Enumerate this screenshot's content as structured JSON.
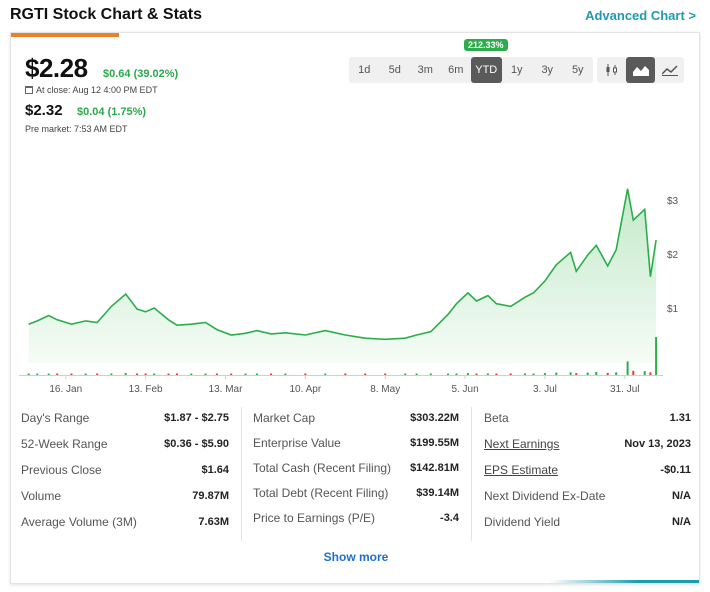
{
  "header": {
    "title": "RGTI Stock Chart & Stats",
    "advanced_link": "Advanced Chart >"
  },
  "quote": {
    "price": "$2.28",
    "change": "$0.64 (39.02%)",
    "close_label": "At close: Aug 12 4:00 PM EDT",
    "premarket_price": "$2.32",
    "premarket_change": "$0.04 (1.75%)",
    "premarket_label": "Pre market: 7:53 AM EDT"
  },
  "range": {
    "buttons": [
      "1d",
      "5d",
      "3m",
      "6m",
      "YTD",
      "1y",
      "3y",
      "5y"
    ],
    "active": "YTD",
    "badge": "212.33%"
  },
  "chart_types": [
    {
      "icon": "candlestick-icon",
      "active": false
    },
    {
      "icon": "mountain-chart-icon",
      "active": true
    },
    {
      "icon": "line-chart-icon",
      "active": false
    }
  ],
  "colors": {
    "line": "#2bae4a",
    "fill": "#bfe8c6",
    "positive": "#2ba84a",
    "accent": "#e8812a",
    "link": "#1e9bb0",
    "volume_up": "#2bae4a",
    "volume_down": "#e23b3b"
  },
  "chart_data": {
    "type": "area",
    "x_tick_labels": [
      "16. Jan",
      "13. Feb",
      "13. Mar",
      "10. Apr",
      "8. May",
      "5. Jun",
      "3. Jul",
      "31. Jul"
    ],
    "y_tick_labels": [
      "$3",
      "$2",
      "$1"
    ],
    "ylim": [
      0,
      3.3
    ],
    "x": [
      "2023-01-03",
      "2023-01-06",
      "2023-01-10",
      "2023-01-13",
      "2023-01-18",
      "2023-01-23",
      "2023-01-27",
      "2023-02-01",
      "2023-02-06",
      "2023-02-10",
      "2023-02-13",
      "2023-02-16",
      "2023-02-21",
      "2023-02-24",
      "2023-03-01",
      "2023-03-06",
      "2023-03-10",
      "2023-03-15",
      "2023-03-20",
      "2023-03-24",
      "2023-03-29",
      "2023-04-03",
      "2023-04-10",
      "2023-04-17",
      "2023-04-24",
      "2023-05-01",
      "2023-05-08",
      "2023-05-15",
      "2023-05-19",
      "2023-05-24",
      "2023-05-30",
      "2023-06-02",
      "2023-06-06",
      "2023-06-09",
      "2023-06-13",
      "2023-06-16",
      "2023-06-21",
      "2023-06-26",
      "2023-06-29",
      "2023-07-03",
      "2023-07-07",
      "2023-07-12",
      "2023-07-14",
      "2023-07-18",
      "2023-07-21",
      "2023-07-25",
      "2023-07-28",
      "2023-08-01",
      "2023-08-03",
      "2023-08-07",
      "2023-08-09",
      "2023-08-11"
    ],
    "values": [
      0.72,
      0.78,
      0.88,
      0.8,
      0.72,
      0.78,
      0.75,
      1.05,
      1.28,
      1.0,
      0.95,
      1.02,
      0.8,
      0.7,
      0.72,
      0.75,
      0.62,
      0.52,
      0.55,
      0.6,
      0.54,
      0.56,
      0.52,
      0.6,
      0.52,
      0.46,
      0.44,
      0.46,
      0.52,
      0.58,
      0.9,
      1.1,
      1.3,
      1.15,
      1.25,
      1.1,
      1.05,
      1.22,
      1.3,
      1.52,
      1.82,
      2.05,
      1.7,
      2.0,
      2.18,
      1.8,
      2.1,
      3.23,
      2.65,
      2.85,
      1.6,
      2.28
    ],
    "volume": [
      0.08,
      0.05,
      0.06,
      0.04,
      0.05,
      0.06,
      0.04,
      0.12,
      0.15,
      0.08,
      0.06,
      0.05,
      0.05,
      0.04,
      0.04,
      0.04,
      0.05,
      0.04,
      0.04,
      0.03,
      0.03,
      0.03,
      0.03,
      0.04,
      0.03,
      0.03,
      0.03,
      0.03,
      0.04,
      0.05,
      0.1,
      0.12,
      0.15,
      0.1,
      0.12,
      0.1,
      0.08,
      0.12,
      0.1,
      0.14,
      0.18,
      0.2,
      0.14,
      0.18,
      0.22,
      0.15,
      0.2,
      1.0,
      0.32,
      0.28,
      0.2,
      2.8
    ]
  },
  "stats": {
    "col1": [
      {
        "label": "Day's Range",
        "value": "$1.87 - $2.75"
      },
      {
        "label": "52-Week Range",
        "value": "$0.36 - $5.90"
      },
      {
        "label": "Previous Close",
        "value": "$1.64"
      },
      {
        "label": "Volume",
        "value": "79.87M"
      },
      {
        "label": "Average Volume (3M)",
        "value": "7.63M"
      }
    ],
    "col2": [
      {
        "label": "Market Cap",
        "value": "$303.22M"
      },
      {
        "label": "Enterprise Value",
        "value": "$199.55M"
      },
      {
        "label": "Total Cash (Recent Filing)",
        "value": "$142.81M"
      },
      {
        "label": "Total Debt (Recent Filing)",
        "value": "$39.14M"
      },
      {
        "label": "Price to Earnings (P/E)",
        "value": "-3.4"
      }
    ],
    "col3": [
      {
        "label": "Beta",
        "value": "1.31"
      },
      {
        "label": "Next Earnings",
        "value": "Nov 13, 2023"
      },
      {
        "label": "EPS Estimate",
        "value": "-$0.11"
      },
      {
        "label": "Next Dividend Ex-Date",
        "value": "N/A"
      },
      {
        "label": "Dividend Yield",
        "value": "N/A"
      }
    ]
  },
  "show_more": "Show more"
}
